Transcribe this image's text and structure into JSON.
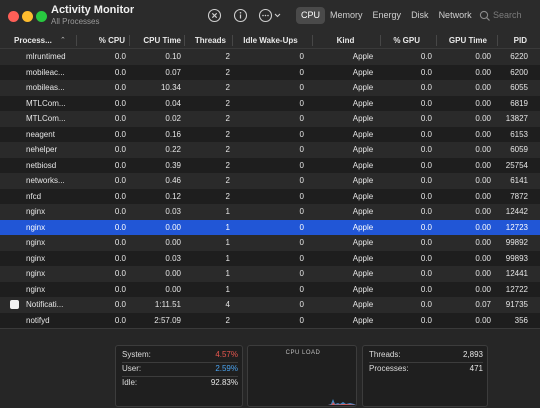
{
  "window": {
    "title": "Activity Monitor",
    "subtitle": "All Processes",
    "tabs": [
      {
        "label": "CPU",
        "active": true
      },
      {
        "label": "Memory",
        "active": false
      },
      {
        "label": "Energy",
        "active": false
      },
      {
        "label": "Disk",
        "active": false
      },
      {
        "label": "Network",
        "active": false
      }
    ],
    "search_placeholder": "Search",
    "icons": {
      "stop": "stop-process-icon",
      "info": "info-icon",
      "more": "more-options-icon",
      "search": "search-icon"
    }
  },
  "table": {
    "columns": [
      "Process...",
      "% CPU",
      "CPU Time",
      "Threads",
      "Idle Wake-Ups",
      "Kind",
      "% GPU",
      "GPU Time",
      "PID"
    ],
    "selected_pid": "12723",
    "rows": [
      {
        "name": "mlruntimed",
        "cpu": "0.0",
        "cpu_time": "0.10",
        "threads": "2",
        "idle": "0",
        "kind": "Apple",
        "gpu": "0.0",
        "gpu_time": "0.00",
        "pid": "6220"
      },
      {
        "name": "mobileac...",
        "cpu": "0.0",
        "cpu_time": "0.07",
        "threads": "2",
        "idle": "0",
        "kind": "Apple",
        "gpu": "0.0",
        "gpu_time": "0.00",
        "pid": "6200"
      },
      {
        "name": "mobileas...",
        "cpu": "0.0",
        "cpu_time": "10.34",
        "threads": "2",
        "idle": "0",
        "kind": "Apple",
        "gpu": "0.0",
        "gpu_time": "0.00",
        "pid": "6055"
      },
      {
        "name": "MTLCom...",
        "cpu": "0.0",
        "cpu_time": "0.04",
        "threads": "2",
        "idle": "0",
        "kind": "Apple",
        "gpu": "0.0",
        "gpu_time": "0.00",
        "pid": "6819"
      },
      {
        "name": "MTLCom...",
        "cpu": "0.0",
        "cpu_time": "0.02",
        "threads": "2",
        "idle": "0",
        "kind": "Apple",
        "gpu": "0.0",
        "gpu_time": "0.00",
        "pid": "13827"
      },
      {
        "name": "neagent",
        "cpu": "0.0",
        "cpu_time": "0.16",
        "threads": "2",
        "idle": "0",
        "kind": "Apple",
        "gpu": "0.0",
        "gpu_time": "0.00",
        "pid": "6153"
      },
      {
        "name": "nehelper",
        "cpu": "0.0",
        "cpu_time": "0.22",
        "threads": "2",
        "idle": "0",
        "kind": "Apple",
        "gpu": "0.0",
        "gpu_time": "0.00",
        "pid": "6059"
      },
      {
        "name": "netbiosd",
        "cpu": "0.0",
        "cpu_time": "0.39",
        "threads": "2",
        "idle": "0",
        "kind": "Apple",
        "gpu": "0.0",
        "gpu_time": "0.00",
        "pid": "25754"
      },
      {
        "name": "networks...",
        "cpu": "0.0",
        "cpu_time": "0.46",
        "threads": "2",
        "idle": "0",
        "kind": "Apple",
        "gpu": "0.0",
        "gpu_time": "0.00",
        "pid": "6141"
      },
      {
        "name": "nfcd",
        "cpu": "0.0",
        "cpu_time": "0.12",
        "threads": "2",
        "idle": "0",
        "kind": "Apple",
        "gpu": "0.0",
        "gpu_time": "0.00",
        "pid": "7872"
      },
      {
        "name": "nginx",
        "cpu": "0.0",
        "cpu_time": "0.03",
        "threads": "1",
        "idle": "0",
        "kind": "Apple",
        "gpu": "0.0",
        "gpu_time": "0.00",
        "pid": "12442"
      },
      {
        "name": "nginx",
        "cpu": "0.0",
        "cpu_time": "0.00",
        "threads": "1",
        "idle": "0",
        "kind": "Apple",
        "gpu": "0.0",
        "gpu_time": "0.00",
        "pid": "12723"
      },
      {
        "name": "nginx",
        "cpu": "0.0",
        "cpu_time": "0.00",
        "threads": "1",
        "idle": "0",
        "kind": "Apple",
        "gpu": "0.0",
        "gpu_time": "0.00",
        "pid": "99892"
      },
      {
        "name": "nginx",
        "cpu": "0.0",
        "cpu_time": "0.03",
        "threads": "1",
        "idle": "0",
        "kind": "Apple",
        "gpu": "0.0",
        "gpu_time": "0.00",
        "pid": "99893"
      },
      {
        "name": "nginx",
        "cpu": "0.0",
        "cpu_time": "0.00",
        "threads": "1",
        "idle": "0",
        "kind": "Apple",
        "gpu": "0.0",
        "gpu_time": "0.00",
        "pid": "12441"
      },
      {
        "name": "nginx",
        "cpu": "0.0",
        "cpu_time": "0.00",
        "threads": "1",
        "idle": "0",
        "kind": "Apple",
        "gpu": "0.0",
        "gpu_time": "0.00",
        "pid": "12722"
      },
      {
        "name": "Notificati...",
        "cpu": "0.0",
        "cpu_time": "1:11.51",
        "threads": "4",
        "idle": "0",
        "kind": "Apple",
        "gpu": "0.0",
        "gpu_time": "0.07",
        "pid": "91735",
        "has_icon": true
      },
      {
        "name": "notifyd",
        "cpu": "0.0",
        "cpu_time": "2:57.09",
        "threads": "2",
        "idle": "0",
        "kind": "Apple",
        "gpu": "0.0",
        "gpu_time": "0.00",
        "pid": "356"
      }
    ]
  },
  "summary": {
    "system_label": "System:",
    "system_value": "4.57%",
    "user_label": "User:",
    "user_value": "2.59%",
    "idle_label": "Idle:",
    "idle_value": "92.83%",
    "cpu_load_title": "CPU LOAD",
    "threads_label": "Threads:",
    "threads_value": "2,893",
    "processes_label": "Processes:",
    "processes_value": "471",
    "colors": {
      "system": "#e8574f",
      "user": "#4ba3ef"
    }
  }
}
